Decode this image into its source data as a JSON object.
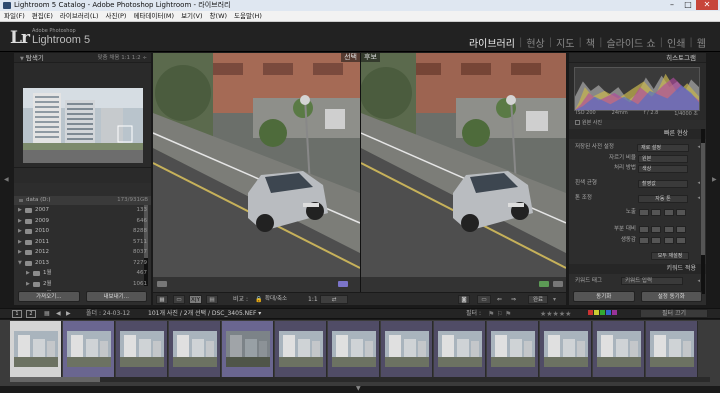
{
  "window": {
    "title": "Lightroom 5 Catalog - Adobe Photoshop Lightroom - 라이브러리",
    "minimize": "–",
    "maximize": "□",
    "close": "✕"
  },
  "menu": [
    "파일(F)",
    "편집(E)",
    "라이브러리(L)",
    "사진(P)",
    "메타데이터(M)",
    "보기(V)",
    "창(W)",
    "도움말(H)"
  ],
  "brand": {
    "logo": "Lr",
    "small": "Adobe Photoshop",
    "name": "Lightroom 5"
  },
  "modules": [
    "라이브러리",
    "현상",
    "지도",
    "책",
    "슬라이드 쇼",
    "인쇄",
    "웹"
  ],
  "navigator": {
    "title": "탐색기",
    "opts": "맞춤  채움  1:1  1:2 ÷"
  },
  "folders": {
    "volume": "data (D:)",
    "volume_size": "173/931GB",
    "rows": [
      {
        "name": "2007",
        "count": "133"
      },
      {
        "name": "2009",
        "count": "646"
      },
      {
        "name": "2010",
        "count": "8288"
      },
      {
        "name": "2011",
        "count": "5711"
      },
      {
        "name": "2012",
        "count": "8037"
      },
      {
        "name": "2013",
        "count": "7279"
      },
      {
        "name": "1월",
        "count": "467"
      },
      {
        "name": "2월",
        "count": "1061"
      },
      {
        "name": "3월",
        "count": "820"
      }
    ],
    "import_btn": "가져오기...",
    "export_btn": "내보내기..."
  },
  "compare": {
    "select_label": "선택",
    "candidate_label": "후보"
  },
  "toolbar": {
    "compare_label": "비교 :",
    "zoom_label": "확대/축소",
    "zoom_value": "1:1",
    "done": "완료",
    "view_xy": "X|Y"
  },
  "histogram": {
    "title": "히스토그램",
    "iso": "ISO 200",
    "focal": "24mm",
    "aperture": "f / 2.8",
    "shutter": "1/4000 초",
    "original": "원본 사진"
  },
  "quick_develop": {
    "title": "빠른 현상",
    "saved_preset_label": "저장된 사전 설정",
    "saved_preset_value": "재로 설정",
    "crop_label": "자르기 비율",
    "crop_value": "원본",
    "treatment_label": "처리 방법",
    "treatment_value": "색상",
    "wb_label": "흰색 균형",
    "wb_value": "촬영값",
    "tone_label": "톤 조정",
    "tone_value": "자동 톤",
    "exposure_label": "노출",
    "clarity_label": "부분 대비",
    "vibrance_label": "생동감",
    "reset_btn": "모두 재설정"
  },
  "keywording": {
    "title": "키워드 적용",
    "tags_label": "키워드 태그",
    "tags_value": "키워드 입력",
    "sync_metadata_btn": "동기화",
    "sync_settings_btn": "설정 동기화"
  },
  "filmstrip_bar": {
    "page1": "1",
    "page2": "2",
    "path": "폴더 : 24-03-12",
    "count": "101개 사진 / 2개 선택 / DSC_3405.NEF ▾",
    "filter_label": "필터 :",
    "filter_off": "필터 끄기"
  },
  "colors": {
    "accent": "#7b74c9",
    "panel": "#2d2d2d",
    "frame_bg": "#504c66"
  }
}
